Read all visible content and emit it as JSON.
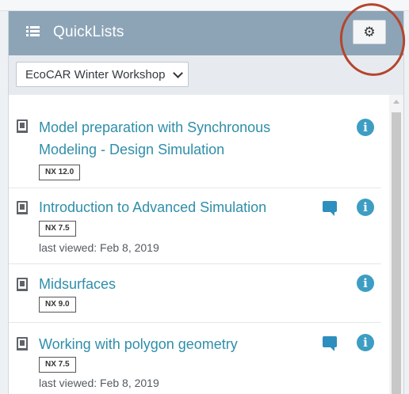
{
  "header": {
    "title": "QuickLists",
    "list_icon": "list-icon",
    "settings_icon": "gear-icon",
    "settings_glyph": "⚙"
  },
  "dropdown": {
    "selected": "EcoCAR Winter Workshop",
    "icon": "chevron-down-icon"
  },
  "items": [
    {
      "title": "Model preparation with Synchronous Modeling - Design Simulation",
      "version": "NX 12.0",
      "last_viewed": "",
      "has_comment": false
    },
    {
      "title": "Introduction to Advanced Simulation",
      "version": "NX 7.5",
      "last_viewed": "last viewed: Feb 8, 2019",
      "has_comment": true
    },
    {
      "title": "Midsurfaces",
      "version": "NX 9.0",
      "last_viewed": "",
      "has_comment": false
    },
    {
      "title": "Working with polygon geometry",
      "version": "NX 7.5",
      "last_viewed": "last viewed: Feb 8, 2019",
      "has_comment": true
    }
  ],
  "info_glyph": "i",
  "colors": {
    "header_bg": "#8da4b7",
    "link": "#2f8eaa",
    "info": "#3d9dc3",
    "annotation": "#b5452e"
  }
}
